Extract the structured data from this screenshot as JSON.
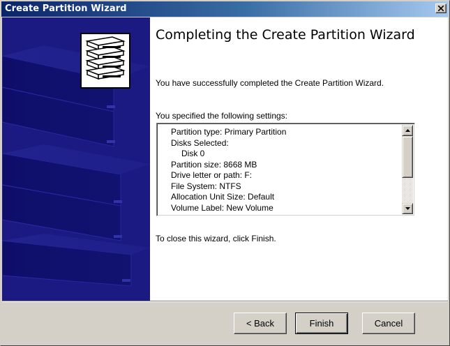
{
  "window": {
    "title": "Create Partition Wizard",
    "close_icon": "close-x-icon"
  },
  "side_panel": {
    "logo_icon": "stacked-disks-icon",
    "background": "blue-disk-drive-illustration"
  },
  "main": {
    "heading": "Completing the Create Partition Wizard",
    "description": "You have successfully completed the Create Partition Wizard.",
    "settings_label": "You specified the following settings:",
    "settings": [
      "Partition type: Primary Partition",
      "Disks Selected:",
      "Disk 0",
      "Partition size: 8668 MB",
      "Drive letter or path: F:",
      "File System: NTFS",
      "Allocation Unit Size: Default",
      "Volume Label: New Volume"
    ],
    "close_hint": "To close this wizard, click Finish."
  },
  "buttons": {
    "back": "< Back",
    "finish": "Finish",
    "cancel": "Cancel"
  },
  "colors": {
    "titlebar_start": "#0a246a",
    "titlebar_end": "#a6caf0",
    "side_panel": "#1a1a82",
    "face": "#d4d0c8"
  }
}
